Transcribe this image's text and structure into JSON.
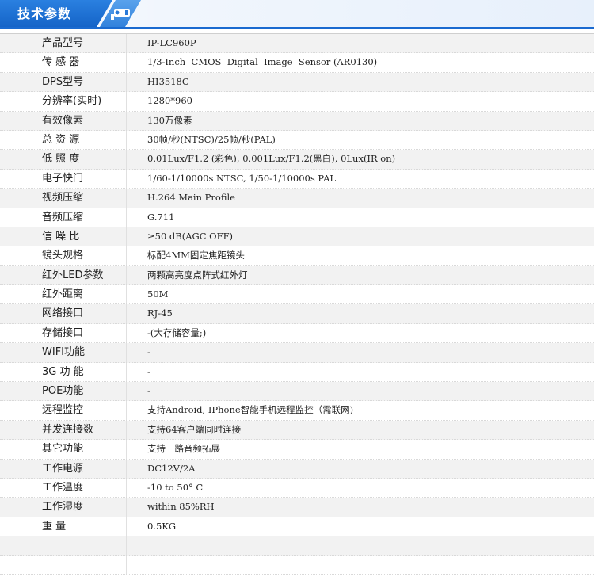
{
  "header": {
    "title": "技术参数",
    "icon": "camera-icon"
  },
  "specs": [
    {
      "label": "产品型号",
      "value": "IP-LC960P"
    },
    {
      "label": "传 感 器",
      "value": "1/3-Inch  CMOS  Digital  Image  Sensor (AR0130)"
    },
    {
      "label": "DPS型号",
      "value": "HI3518C"
    },
    {
      "label": "分辨率(实时)",
      "value": "1280*960"
    },
    {
      "label": "有效像素",
      "value": "130万像素"
    },
    {
      "label": "总 资 源",
      "value": "30帧/秒(NTSC)/25帧/秒(PAL)"
    },
    {
      "label": "低 照 度",
      "value": "0.01Lux/F1.2 (彩色), 0.001Lux/F1.2(黑白), 0Lux(IR on)"
    },
    {
      "label": "电子快门",
      "value": "1/60-1/10000s NTSC, 1/50-1/10000s PAL"
    },
    {
      "label": "视频压缩",
      "value": "H.264 Main Profile"
    },
    {
      "label": "音频压缩",
      "value": "G.711"
    },
    {
      "label": "信 噪 比",
      "value": "≥50 dB(AGC OFF)"
    },
    {
      "label": "镜头规格",
      "value": "标配4MM固定焦距镜头"
    },
    {
      "label": "红外LED参数",
      "value": "两颗高亮度点阵式红外灯"
    },
    {
      "label": "红外距离",
      "value": "50M"
    },
    {
      "label": "网络接口",
      "value": "RJ-45"
    },
    {
      "label": "存储接口",
      "value": "-(大存储容量;)"
    },
    {
      "label": "WIFI功能",
      "value": "-"
    },
    {
      "label": "3G 功 能",
      "value": "-"
    },
    {
      "label": "POE功能",
      "value": "-"
    },
    {
      "label": "远程监控",
      "value": "支持Android, IPhone智能手机远程监控（需联网)"
    },
    {
      "label": "并发连接数",
      "value": "支持64客户端同时连接"
    },
    {
      "label": "其它功能",
      "value": "支持一路音频拓展"
    },
    {
      "label": "工作电源",
      "value": "DC12V/2A"
    },
    {
      "label": "工作温度",
      "value": "-10 to 50° C"
    },
    {
      "label": "工作湿度",
      "value": "within 85%RH"
    },
    {
      "label": "重    量",
      "value": "0.5KG"
    },
    {
      "label": "",
      "value": ""
    },
    {
      "label": "",
      "value": ""
    }
  ]
}
